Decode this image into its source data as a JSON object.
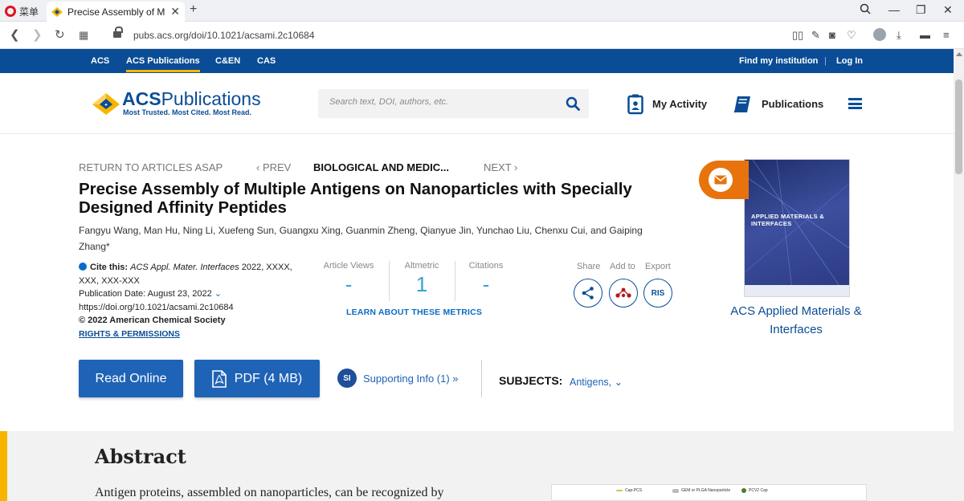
{
  "browser": {
    "menu_label": "菜单",
    "tab_title": "Precise Assembly of Multiple",
    "url": "pubs.acs.org/doi/10.1021/acsami.2c10684"
  },
  "acs_nav": {
    "items": [
      "ACS",
      "ACS Publications",
      "C&EN",
      "CAS"
    ],
    "find_institution": "Find my institution",
    "separator": "|",
    "login": "Log In"
  },
  "header": {
    "logo_name_bold": "ACS",
    "logo_name_rest": "Publications",
    "tagline": "Most Trusted. Most Cited. Most Read.",
    "search_placeholder": "Search text, DOI, authors, etc.",
    "my_activity": "My Activity",
    "publications": "Publications"
  },
  "breadcrumbs": {
    "return": "RETURN TO ARTICLES ASAP",
    "prev": "‹ PREV",
    "current": "BIOLOGICAL AND MEDIC...",
    "next": "NEXT ›"
  },
  "article": {
    "title": "Precise Assembly of Multiple Antigens on Nanoparticles with Specially Designed Affinity Peptides",
    "authors": "Fangyu Wang, Man Hu, Ning Li, Xuefeng Sun, Guangxu Xing, Guanmin Zheng, Qianyue Jin, Yunchao Liu, Chenxu Cui, and Gaiping Zhang*",
    "cite_label": "Cite this:",
    "cite_journal": "ACS Appl. Mater. Interfaces",
    "cite_rest": "2022, XXXX, XXX, XXX-XXX",
    "pub_date": "Publication Date: August 23, 2022",
    "doi": "https://doi.org/10.1021/acsami.2c10684",
    "copyright": "© 2022 American Chemical Society",
    "rights": "RIGHTS & PERMISSIONS"
  },
  "metrics": {
    "views_label": "Article Views",
    "views_value": "-",
    "altmetric_label": "Altmetric",
    "altmetric_value": "1",
    "citations_label": "Citations",
    "citations_value": "-",
    "learn_more": "LEARN ABOUT THESE METRICS"
  },
  "actions": {
    "share": "Share",
    "add_to": "Add to",
    "export": "Export",
    "ris": "RIS"
  },
  "journal": {
    "name": "ACS Applied Materials & Interfaces",
    "cover_banner": "APPLIED MATERIALS & INTERFACES"
  },
  "buttons": {
    "read_online": "Read Online",
    "pdf": "PDF (4 MB)",
    "si_badge": "SI",
    "supporting_info": "Supporting Info (1) »",
    "subjects_label": "SUBJECTS:",
    "subjects_value": "Antigens, ⌄"
  },
  "abstract": {
    "heading": "Abstract",
    "first_line": "Antigen proteins, assembled on nanoparticles, can be recognized by",
    "legend": [
      "Cap-PCS",
      "GEM or PLGA Nanoparticle",
      "PCV2 Cap"
    ]
  },
  "colors": {
    "acs_blue": "#0a4d96",
    "accent_yellow": "#f7b500",
    "button_blue": "#1f63b6",
    "mail_orange": "#e8730c",
    "metric_teal": "#3aa0d9"
  }
}
